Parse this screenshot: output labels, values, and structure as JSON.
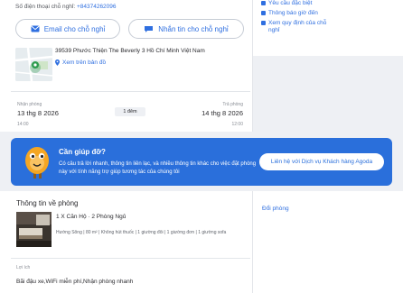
{
  "contact": {
    "phone_label": "Số điện thoại chỗ nghỉ:",
    "phone_number": "+84374262096",
    "email_button": "Email cho chỗ nghỉ",
    "message_button": "Nhắn tin cho chỗ nghỉ"
  },
  "location": {
    "address": "39539 Phước Thiện The Beverly 3 Hồ Chí Minh Việt Nam",
    "map_link": "Xem trên bản đồ"
  },
  "stay": {
    "checkin_label": "Nhận phòng",
    "checkin_date": "13 thg 8 2026",
    "checkin_time": "14:00",
    "nights": "1 đêm",
    "checkout_label": "Trả phòng",
    "checkout_date": "14 thg 8 2026",
    "checkout_time": "12:00"
  },
  "side_links": [
    {
      "label": "Yêu cầu đặc biệt"
    },
    {
      "label": "Thông báo giờ đến"
    },
    {
      "label": "Xem quy định của chỗ"
    },
    {
      "label": "nghỉ"
    }
  ],
  "help": {
    "title": "Cần giúp đỡ?",
    "description": "Có câu trả lời nhanh, thông tin liên lạc, và nhiều thông tin khác cho việc đặt phòng này với tính năng trợ giúp tương tác của chúng tôi",
    "button": "Liên hệ với Dịch vụ Khách hàng Agoda"
  },
  "room": {
    "section_title": "Thông tin về phòng",
    "change_room": "Đổi phòng",
    "name": "1 X Căn Hộ · 2 Phòng Ngủ",
    "details": "Hướng Sông | 80 m² | Không hút thuốc | 1 giường đôi | 1 giường đơn | 1 giường sofa",
    "benefits_label": "Lợi ích",
    "benefits": "Bãi đậu xe,WiFi miễn phí,Nhận phòng nhanh"
  },
  "colors": {
    "accent": "#2f6fe0",
    "banner": "#2a6fdb",
    "background": "#eef0f4"
  },
  "icons": {
    "email": "envelope-icon",
    "message": "chat-icon",
    "map_pin": "map-pin-icon",
    "mascot": "agoda-mascot-icon"
  }
}
